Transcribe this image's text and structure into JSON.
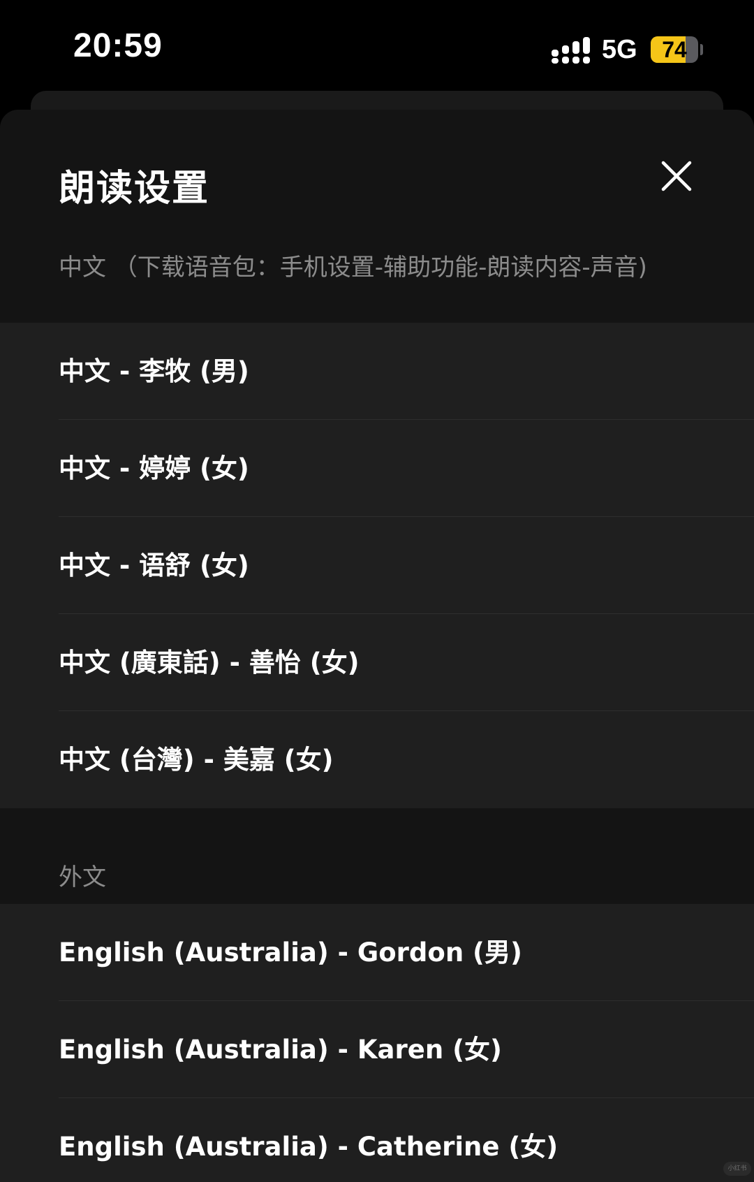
{
  "status_bar": {
    "time": "20:59",
    "network": "5G",
    "battery_level": "74",
    "battery_fraction": 0.74,
    "signal_icon": "signal-bars-icon",
    "battery_color": "#f5c518"
  },
  "sheet": {
    "title": "朗读设置",
    "close_icon": "close-icon"
  },
  "chinese_section": {
    "label": "中文 （下载语音包：手机设置-辅助功能-朗读内容-声音)",
    "items": [
      {
        "label": "中文 - 李牧 (男)"
      },
      {
        "label": "中文 - 婷婷 (女)"
      },
      {
        "label": "中文 - 语舒 (女)"
      },
      {
        "label": "中文 (廣東話) - 善怡 (女)"
      },
      {
        "label": "中文 (台灣) - 美嘉 (女)"
      }
    ]
  },
  "foreign_section": {
    "label": "外文",
    "items": [
      {
        "label": "English (Australia) - Gordon (男)"
      },
      {
        "label": "English (Australia) - Karen (女)"
      },
      {
        "label": "English (Australia) - Catherine (女)"
      }
    ]
  },
  "watermark": {
    "text": "小红书"
  }
}
